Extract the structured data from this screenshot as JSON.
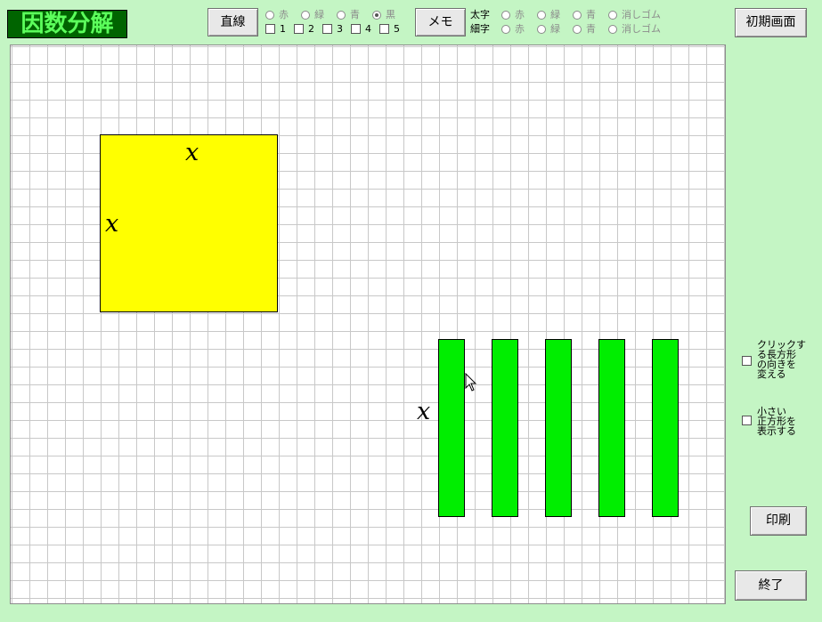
{
  "app": {
    "title": "因数分解"
  },
  "toolbar": {
    "line_button": "直線",
    "line_colors": [
      {
        "label": "赤",
        "checked": false
      },
      {
        "label": "緑",
        "checked": false
      },
      {
        "label": "青",
        "checked": false
      },
      {
        "label": "黒",
        "checked": true
      }
    ],
    "line_checks": [
      "1",
      "2",
      "3",
      "4",
      "5"
    ],
    "memo_button": "メモ",
    "thick_label": "太字",
    "thin_label": "細字",
    "pen_options": [
      "赤",
      "緑",
      "青",
      "消しゴム"
    ],
    "reset_button": "初期画面"
  },
  "canvas": {
    "square_top_label": "x",
    "square_left_label": "x",
    "bars_label": "x",
    "bars_count": 5
  },
  "side": {
    "rotate_option": "クリックする長方形の向きを変える",
    "rotate_lines": [
      "クリックす",
      "る長方形",
      "の向きを",
      "変える"
    ],
    "small_square_lines": [
      "小さい",
      "正方形を",
      "表示する"
    ],
    "print_button": "印刷",
    "exit_button": "終了"
  },
  "colors": {
    "background": "#c4f5c4",
    "square": "#ffff00",
    "bars": "#00ee00",
    "title_bg": "#006400",
    "title_fg": "#5cff5c"
  }
}
